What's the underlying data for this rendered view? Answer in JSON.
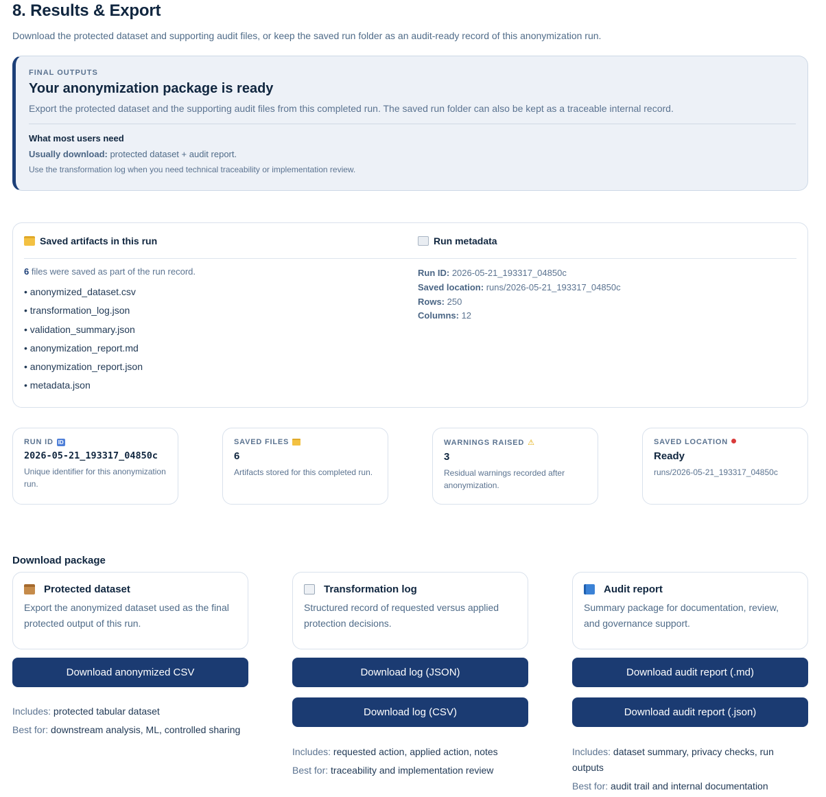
{
  "page": {
    "title": "8. Results & Export",
    "subtitle": "Download the protected dataset and supporting audit files, or keep the saved run folder as an audit-ready record of this anonymization run."
  },
  "hero": {
    "eyebrow": "FINAL OUTPUTS",
    "title": "Your anonymization package is ready",
    "description": "Export the protected dataset and the supporting audit files from this completed run. The saved run folder can also be kept as a traceable internal record.",
    "need_title": "What most users need",
    "usually_label": "Usually download:",
    "usually_value": " protected dataset + audit report.",
    "note": "Use the transformation log when you need technical traceability or implementation review."
  },
  "artifacts": {
    "title": "Saved artifacts in this run",
    "icon": "folder-icon",
    "count": "6",
    "count_text": " files were saved as part of the run record.",
    "files": [
      "• anonymized_dataset.csv",
      "• transformation_log.json",
      "• validation_summary.json",
      "• anonymization_report.md",
      "• anonymization_report.json",
      "• metadata.json"
    ]
  },
  "metadata": {
    "title": "Run metadata",
    "icon": "document-icon",
    "rows": [
      {
        "label": "Run ID:",
        "value": " 2026-05-21_193317_04850c"
      },
      {
        "label": "Saved location:",
        "value": " runs/2026-05-21_193317_04850c"
      },
      {
        "label": "Rows:",
        "value": " 250"
      },
      {
        "label": "Columns:",
        "value": " 12"
      }
    ]
  },
  "stats": [
    {
      "label": "RUN ID",
      "icon": "id-badge-icon",
      "badge": "ID",
      "value": "2026-05-21_193317_04850c",
      "desc": "Unique identifier for this anonymization run."
    },
    {
      "label": "SAVED FILES",
      "icon": "folder-icon",
      "value": "6",
      "desc": "Artifacts stored for this completed run."
    },
    {
      "label": "WARNINGS RAISED",
      "icon": "warning-icon",
      "value": "3",
      "desc": "Residual warnings recorded after anonymization."
    },
    {
      "label": "SAVED LOCATION",
      "icon": "pin-icon",
      "value": "Ready",
      "desc": "runs/2026-05-21_193317_04850c"
    }
  ],
  "download": {
    "title": "Download package",
    "cards": [
      {
        "title": "Protected dataset",
        "icon": "package-icon",
        "desc": "Export the anonymized dataset used as the final protected output of this run.",
        "buttons": [
          "Download anonymized CSV"
        ],
        "includes_label": "Includes:",
        "includes_value": " protected tabular dataset",
        "bestfor_label": "Best for:",
        "bestfor_value": " downstream analysis, ML, controlled sharing"
      },
      {
        "title": "Transformation log",
        "icon": "log-icon",
        "desc": "Structured record of requested versus applied protection decisions.",
        "buttons": [
          "Download log (JSON)",
          "Download log (CSV)"
        ],
        "includes_label": "Includes:",
        "includes_value": " requested action, applied action, notes",
        "bestfor_label": "Best for:",
        "bestfor_value": " traceability and implementation review"
      },
      {
        "title": "Audit report",
        "icon": "book-icon",
        "desc": "Summary package for documentation, review, and governance support.",
        "buttons": [
          "Download audit report (.md)",
          "Download audit report (.json)"
        ],
        "includes_label": "Includes:",
        "includes_value": " dataset summary, privacy checks, run outputs",
        "bestfor_label": "Best for:",
        "bestfor_value": " audit trail and internal documentation"
      }
    ]
  },
  "colors": {
    "accent": "#1b3b72",
    "hero_bg": "#edf1f7",
    "muted_text": "#5b7390"
  }
}
